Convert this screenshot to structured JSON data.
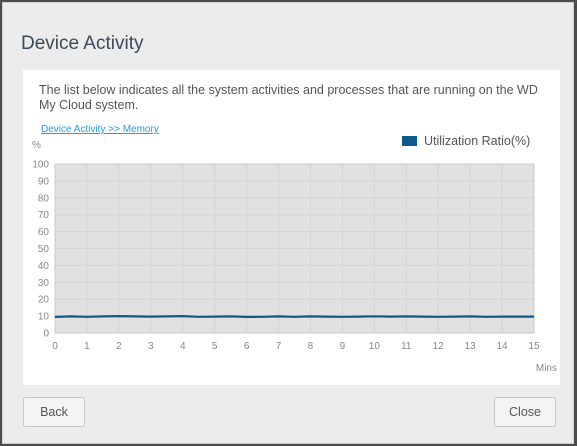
{
  "dialog": {
    "title": "Device Activity",
    "description": "The list below indicates all the system activities and processes that are running on the WD My Cloud system.",
    "breadcrumb": "Device Activity >> Memory",
    "back_label": "Back",
    "close_label": "Close"
  },
  "chart_data": {
    "type": "line",
    "ylabel": "%",
    "xlabel": "Mins",
    "xlim": [
      0,
      15
    ],
    "ylim": [
      0,
      100
    ],
    "x_ticks": [
      0,
      1,
      2,
      3,
      4,
      5,
      6,
      7,
      8,
      9,
      10,
      11,
      12,
      13,
      14,
      15
    ],
    "y_ticks": [
      0,
      10,
      20,
      30,
      40,
      50,
      60,
      70,
      80,
      90,
      100
    ],
    "grid": true,
    "legend_position": "top-right",
    "series": [
      {
        "name": "Utilization Ratio(%)",
        "color": "#0f5a8c",
        "x": [
          0,
          0.5,
          1,
          1.5,
          2,
          2.5,
          3,
          3.5,
          4,
          4.5,
          5,
          5.5,
          6,
          6.5,
          7,
          7.5,
          8,
          8.5,
          9,
          9.5,
          10,
          10.5,
          11,
          11.5,
          12,
          12.5,
          13,
          13.5,
          14,
          14.5,
          15
        ],
        "values": [
          9.5,
          9.8,
          9.6,
          9.8,
          10.0,
          9.8,
          9.7,
          9.8,
          10.0,
          9.6,
          9.7,
          9.8,
          9.5,
          9.6,
          9.8,
          9.6,
          9.8,
          9.7,
          9.6,
          9.7,
          9.9,
          9.7,
          9.8,
          9.7,
          9.6,
          9.7,
          9.8,
          9.6,
          9.7,
          9.7,
          9.7
        ]
      }
    ]
  }
}
